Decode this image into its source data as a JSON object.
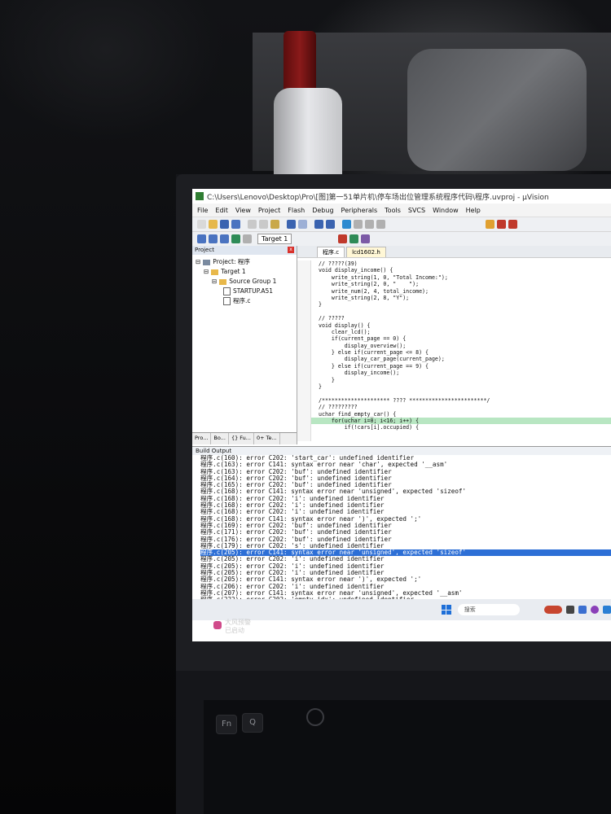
{
  "window": {
    "title": "C:\\Users\\Lenovo\\Desktop\\Pro\\[图]第一51单片机\\停车场出位管理系统程序代码\\程序.uvproj - µVision"
  },
  "menu": [
    "File",
    "Edit",
    "View",
    "Project",
    "Flash",
    "Debug",
    "Peripherals",
    "Tools",
    "SVCS",
    "Window",
    "Help"
  ],
  "toolbar": {
    "target": "Target 1"
  },
  "project_panel": {
    "header": "Project",
    "root": "Project: 程序",
    "target": "Target 1",
    "group": "Source Group 1",
    "files": [
      "STARTUP.A51",
      "程序.c"
    ],
    "tabs": [
      "Pro...",
      "Bo...",
      "{} Fu...",
      "0+ Te..."
    ]
  },
  "editor": {
    "tabs": [
      "程序.c",
      "lcd1602.h"
    ],
    "lines": [
      "// ?????(39)",
      "void display_income() {",
      "    write_string(1, 0, \"Total Income:\");",
      "    write_string(2, 0, \"    \");",
      "    write_num(2, 4, total_income);",
      "    write_string(2, 8, \"Y\");",
      "}",
      "",
      "// ?????",
      "void display() {",
      "    clear_lcd();",
      "    if(current_page == 0) {",
      "        display_overview();",
      "    } else if(current_page <= 8) {",
      "        display_car_page(current_page);",
      "    } else if(current_page == 9) {",
      "        display_income();",
      "    }",
      "}",
      "",
      "/********************* ???? ************************/",
      "// ?????????",
      "uchar find_empty_car() {",
      "    for(uchar i=0; i<16; i++) {",
      "        if(!cars[i].occupied) {"
    ]
  },
  "build": {
    "header": "Build Output",
    "lines": [
      "程序.c(160): error C202: 'start_car': undefined identifier",
      "程序.c(163): error C141: syntax error near 'char', expected '__asm'",
      "程序.c(163): error C202: 'buf': undefined identifier",
      "程序.c(164): error C202: 'buf': undefined identifier",
      "程序.c(165): error C202: 'buf': undefined identifier",
      "程序.c(168): error C141: syntax error near 'unsigned', expected 'sizeof'",
      "程序.c(168): error C202: 'i': undefined identifier",
      "程序.c(168): error C202: 'i': undefined identifier",
      "程序.c(168): error C202: 'i': undefined identifier",
      "程序.c(168): error C141: syntax error near ')', expected ';'",
      "程序.c(169): error C202: 'buf': undefined identifier",
      "程序.c(171): error C202: 'buf': undefined identifier",
      "程序.c(176): error C202: 'buf': undefined identifier",
      "程序.c(179): error C202: 's': undefined identifier",
      "程序.c(205): error C141: syntax error near 'unsigned', expected 'sizeof'",
      "程序.c(205): error C202: 'i': undefined identifier",
      "程序.c(205): error C202: 'i': undefined identifier",
      "程序.c(205): error C202: 'i': undefined identifier",
      "程序.c(205): error C141: syntax error near ')', expected ';'",
      "程序.c(206): error C202: 'i': undefined identifier",
      "程序.c(207): error C141: syntax error near 'unsigned', expected '__asm'",
      "程序.c(222): error C202: 'empty_idx': undefined identifier"
    ],
    "selected_index": 14
  },
  "taskbar": {
    "search": "搜索"
  },
  "notification": {
    "line1": "大风预警",
    "line2": "已启动"
  },
  "laptop_keys": [
    "Fn",
    "Q"
  ]
}
